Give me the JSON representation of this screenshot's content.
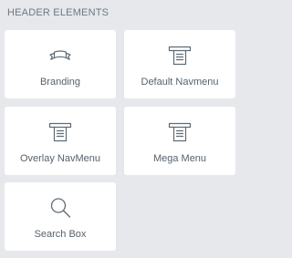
{
  "section": {
    "title": "HEADER ELEMENTS"
  },
  "elements": [
    {
      "label": "Branding",
      "icon": "ribbon-icon"
    },
    {
      "label": "Default Navmenu",
      "icon": "navmenu-icon"
    },
    {
      "label": "Overlay NavMenu",
      "icon": "navmenu-icon"
    },
    {
      "label": "Mega Menu",
      "icon": "navmenu-icon"
    },
    {
      "label": "Search Box",
      "icon": "search-icon"
    }
  ],
  "colors": {
    "background": "#e6e8eb",
    "tile": "#ffffff",
    "text": "#56616c",
    "icon": "#5f6b75"
  }
}
